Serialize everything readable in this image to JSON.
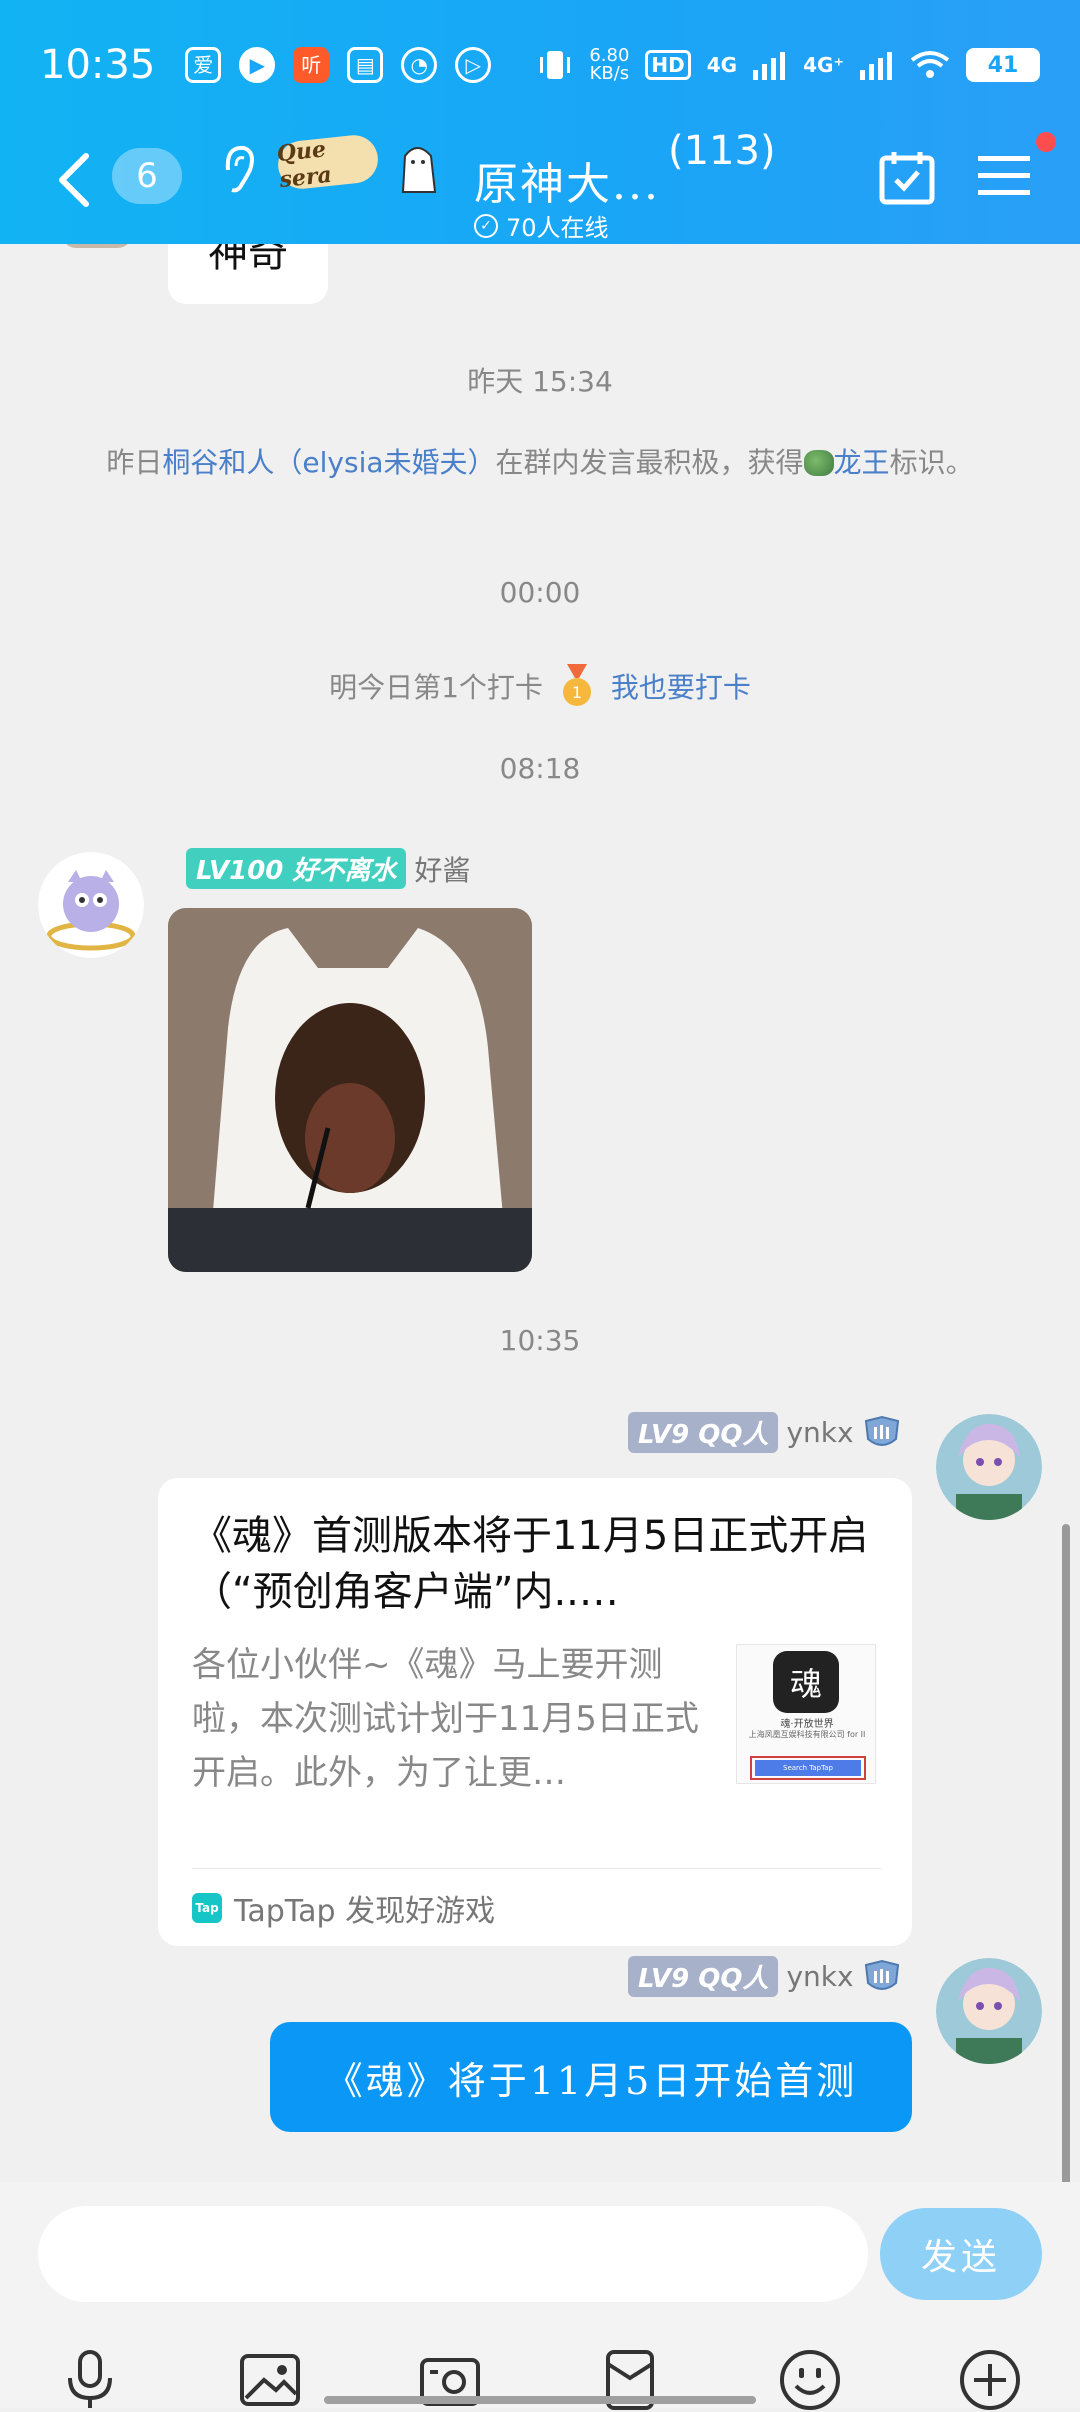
{
  "status_bar": {
    "time": "10:35",
    "net_speed_value": "6.80",
    "net_speed_unit": "KB/s",
    "hd_label": "HD",
    "sim1_label": "4G",
    "sim2_label": "4G⁺",
    "battery": "41"
  },
  "header": {
    "unread_count": "6",
    "group_name": "原神大...",
    "member_count": "(113)",
    "online_status": "70人在线",
    "sticker_text": "Que sera"
  },
  "chat": {
    "partial_message": "神奇",
    "time_1": "昨天 15:34",
    "sys_prefix": "昨日",
    "sys_user": "桐谷和人（elysia未婚夫）",
    "sys_middle": "在群内发言最积极，获得",
    "sys_title": "龙王",
    "sys_suffix": "标识。",
    "time_2": "00:00",
    "checkin_text": "明今日第1个打卡",
    "checkin_link": "我也要打卡",
    "time_3": "08:18",
    "msg1": {
      "level": "LV100",
      "title": "好不离水",
      "sender": "好酱"
    },
    "time_4": "10:35",
    "msg2": {
      "level": "LV9",
      "title": "QQ人",
      "sender": "ynkx",
      "card_title": "《魂》首测版本将于11月5日正式开启（“预创角客户端”内..…",
      "card_desc": "各位小伙伴~《魂》马上要开测啦，本次测试计划于11月5日正式开启。此外，为了让更…",
      "card_source": "TapTap 发现好游戏",
      "thumb_caption": "魂·开放世界",
      "thumb_company": "上海凤凰互娱科技有限公司 for II",
      "thumb_button": "Search TapTap"
    },
    "msg3": {
      "level": "LV9",
      "title": "QQ人",
      "sender": "ynkx",
      "text": "《魂》将于11月5日开始首测"
    }
  },
  "input": {
    "placeholder": "",
    "send_label": "发送"
  },
  "colors": {
    "header_blue": "#1aa5f7",
    "bubble_blue": "#0b97f5",
    "link_blue": "#4a7fc9",
    "send_disabled": "#8fd0f7"
  }
}
